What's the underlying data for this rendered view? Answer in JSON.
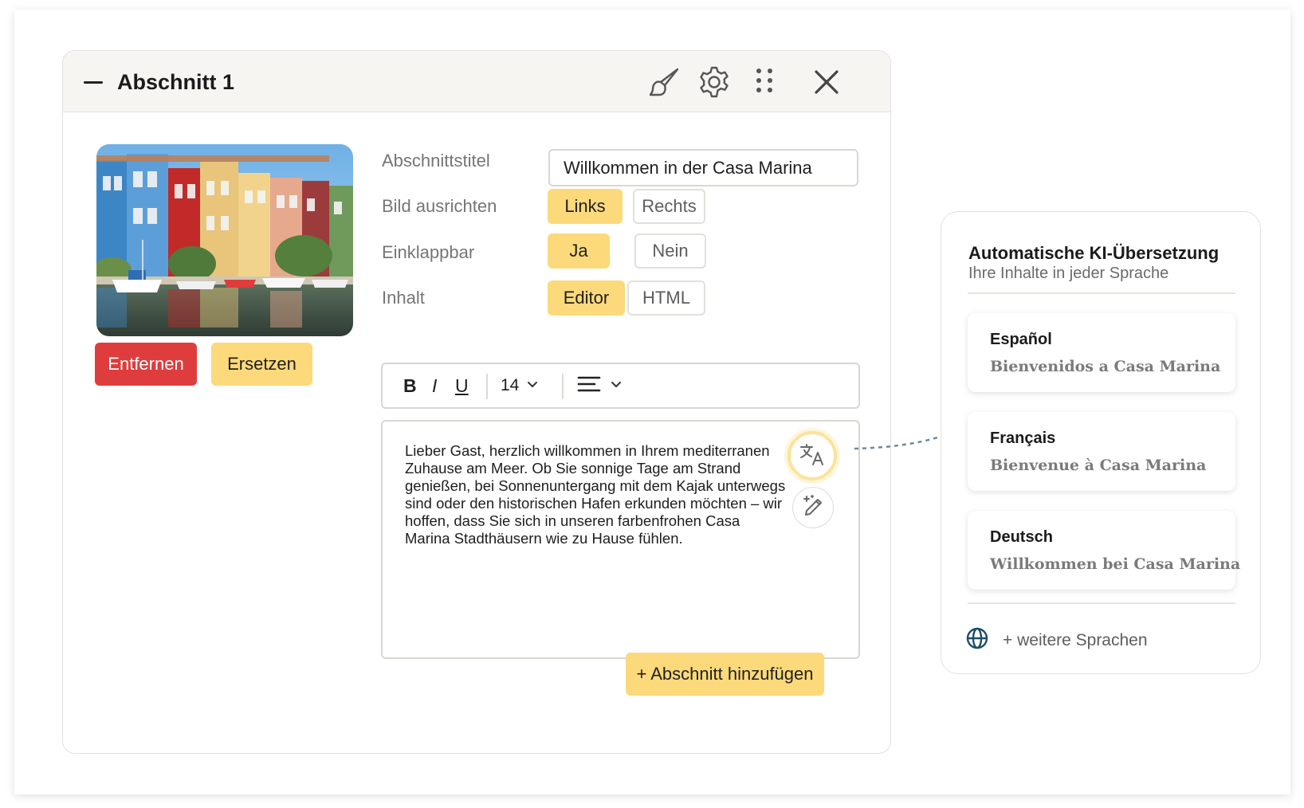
{
  "section": {
    "title": "Abschnitt 1",
    "image_alt": "Bunte Stadthäuser am Hafen",
    "remove_label": "Entfernen",
    "replace_label": "Ersetzen",
    "fields": {
      "title_label": "Abschnittstitel",
      "title_value": "Willkommen in der Casa Marina",
      "align_label": "Bild ausrichten",
      "align_options": [
        "Links",
        "Rechts"
      ],
      "collapsible_label": "Einklappbar",
      "collapsible_options": [
        "Ja",
        "Nein"
      ],
      "content_label": "Inhalt",
      "content_options": [
        "Editor",
        "HTML"
      ]
    },
    "toolbar": {
      "bold": "B",
      "italic": "I",
      "underline": "U",
      "font_size": "14"
    },
    "editor_text": "Lieber Gast, herzlich willkommen in Ihrem mediterranen Zuhause am Meer. Ob Sie sonnige Tage am Strand genießen, bei Sonnenuntergang mit dem Kajak unterwegs sind oder den historischen Hafen erkunden möchten – wir hoffen, dass Sie sich in unseren farbenfrohen Casa Marina Stadthäusern wie zu Hause fühlen.",
    "add_section_label": "+ Abschnitt hinzufügen"
  },
  "translation": {
    "title": "Automatische KI-Übersetzung",
    "subtitle": "Ihre Inhalte in jeder Sprache",
    "languages": [
      {
        "name": "Español",
        "text": "Bienvenidos a Casa Marina"
      },
      {
        "name": "Français",
        "text": "Bienvenue à Casa Marina"
      },
      {
        "name": "Deutsch",
        "text": "Willkommen bei Casa Marina"
      }
    ],
    "more_label": "+ weitere Sprachen"
  },
  "colors": {
    "accent_yellow": "#fcd97a",
    "danger_red": "#df3d3d",
    "globe_icon": "#1e4f66",
    "connector": "#6d8a99"
  },
  "icons": [
    "minus-icon",
    "brush-icon",
    "gear-icon",
    "drag-handle-icon",
    "close-icon",
    "bold-icon",
    "italic-icon",
    "underline-icon",
    "chevron-down-icon",
    "align-icon",
    "translate-icon",
    "magic-pen-icon",
    "globe-icon"
  ]
}
